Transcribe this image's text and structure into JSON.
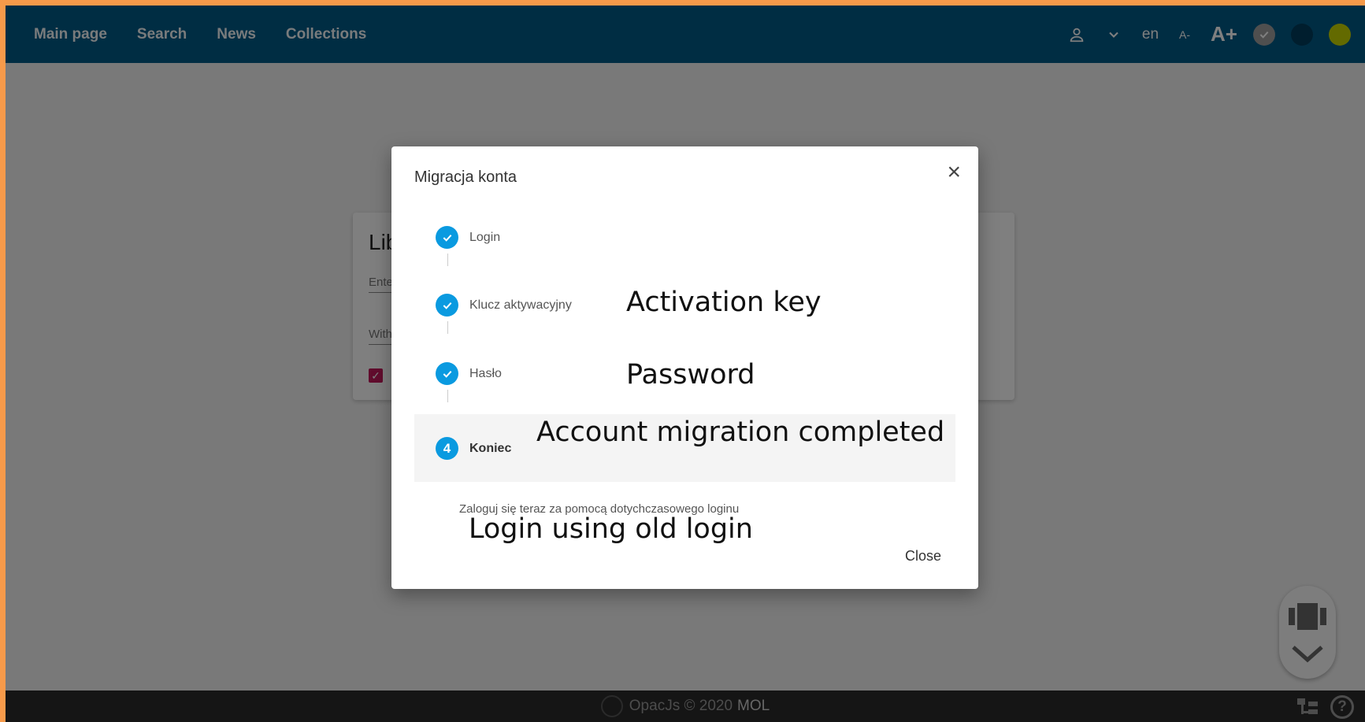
{
  "nav": {
    "items": [
      "Main page",
      "Search",
      "News",
      "Collections"
    ],
    "lang": "en",
    "font_smaller": "A-",
    "font_larger": "A+"
  },
  "background_card": {
    "title_fragment": "Lib",
    "field1_fragment": "Ente",
    "field2_fragment": "With"
  },
  "modal": {
    "title": "Migracja konta",
    "steps": [
      {
        "label": "Login",
        "state": "done"
      },
      {
        "label": "Klucz aktywacyjny",
        "state": "done"
      },
      {
        "label": "Hasło",
        "state": "done"
      },
      {
        "label": "Koniec",
        "state": "active",
        "number": "4"
      }
    ],
    "description": "Zaloguj się teraz za pomocą dotychczasowego loginu",
    "close_button": "Close"
  },
  "annotations": {
    "activation_key": "Activation key",
    "password": "Password",
    "completed": "Account migration completed",
    "login_hint": "Login using old login"
  },
  "footer": {
    "text": "OpacJs © 2020",
    "brand": "MOL"
  },
  "colors": {
    "border": "#f79a4a",
    "topbar": "#005a86",
    "step_dot": "#0a9ae0",
    "checkbox": "#c2185b",
    "footer": "#2a2a2a"
  }
}
